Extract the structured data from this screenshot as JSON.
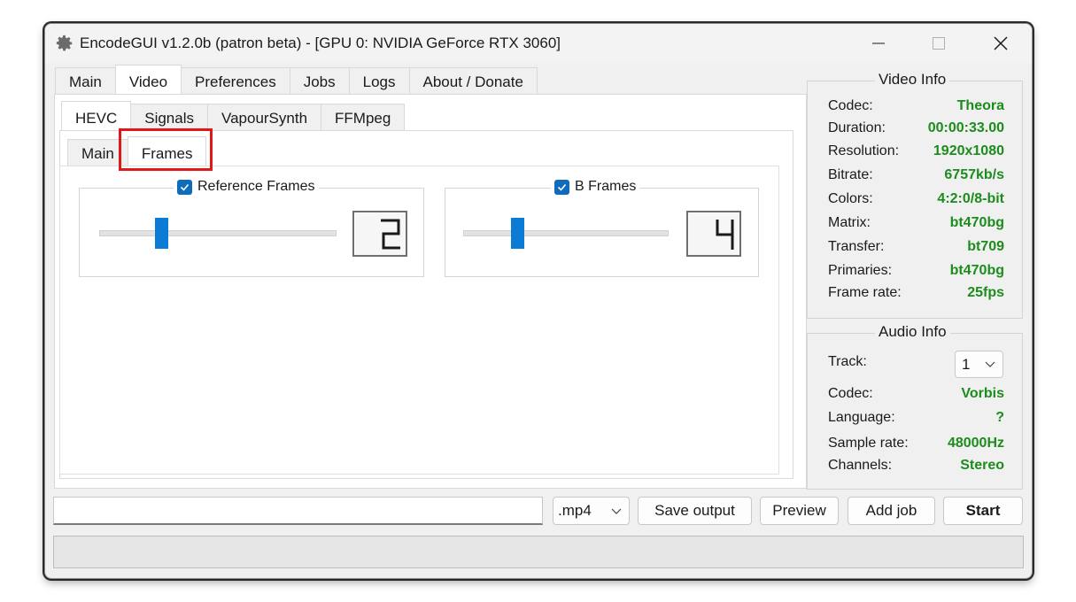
{
  "window": {
    "title": "EncodeGUI v1.2.0b (patron beta) - [GPU 0: NVIDIA GeForce RTX 3060]"
  },
  "main_tabs": [
    "Main",
    "Video",
    "Preferences",
    "Jobs",
    "Logs",
    "About / Donate"
  ],
  "codec_tabs": [
    "HEVC",
    "Signals",
    "VapourSynth",
    "FFMpeg"
  ],
  "sub_tabs": [
    "Main",
    "Frames"
  ],
  "reference_frames": {
    "label": "Reference Frames",
    "checked": true,
    "value": 2
  },
  "b_frames": {
    "label": "B Frames",
    "checked": true,
    "value": 4
  },
  "video_info": {
    "title": "Video Info",
    "rows": [
      {
        "key": "Codec:",
        "value": "Theora"
      },
      {
        "key": "Duration:",
        "value": "00:00:33.00"
      },
      {
        "key": "Resolution:",
        "value": "1920x1080"
      },
      {
        "key": "Bitrate:",
        "value": "6757kb/s"
      },
      {
        "key": "Colors:",
        "value": "4:2:0/8-bit"
      },
      {
        "key": "Matrix:",
        "value": "bt470bg"
      },
      {
        "key": "Transfer:",
        "value": "bt709"
      },
      {
        "key": "Primaries:",
        "value": "bt470bg"
      },
      {
        "key": "Frame rate:",
        "value": "25fps"
      }
    ]
  },
  "audio_info": {
    "title": "Audio Info",
    "track_label": "Track:",
    "track_value": "1",
    "rows": [
      {
        "key": "Codec:",
        "value": "Vorbis"
      },
      {
        "key": "Language:",
        "value": "?"
      },
      {
        "key": "Sample rate:",
        "value": "48000Hz"
      },
      {
        "key": "Channels:",
        "value": "Stereo"
      }
    ]
  },
  "bottom": {
    "output_value": "",
    "container": ".mp4",
    "save_output": "Save output",
    "preview": "Preview",
    "add_job": "Add job",
    "start": "Start"
  },
  "colors": {
    "accent": "#0b7bd6",
    "value_green": "#1c8c1c",
    "highlight_red": "#e01818"
  }
}
